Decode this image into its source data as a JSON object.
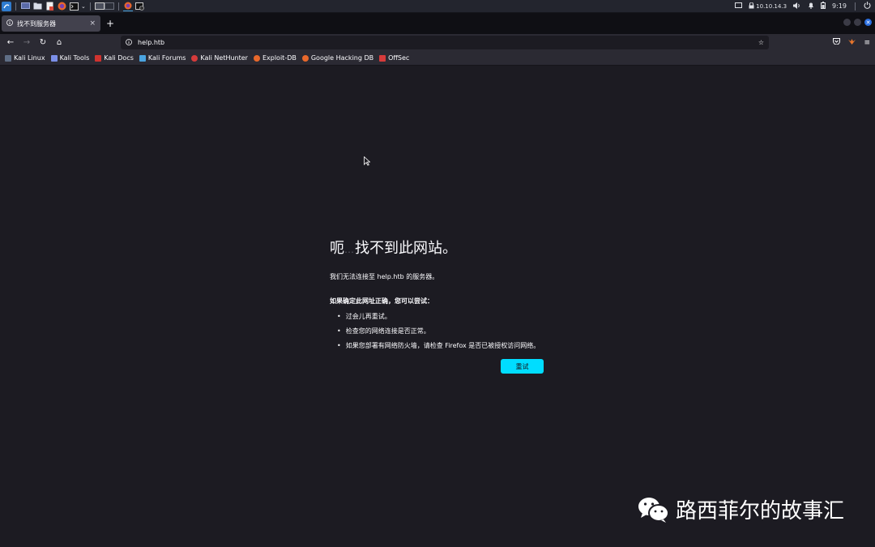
{
  "taskbar": {
    "ip": "10.10.14.3",
    "time": "9:19"
  },
  "tab": {
    "title": "找不到服务器",
    "close": "×",
    "new_tab": "+"
  },
  "nav": {
    "url": "help.htb"
  },
  "bookmarks": [
    {
      "label": "Kali Linux",
      "color": "#5f6e86"
    },
    {
      "label": "Kali Tools",
      "color": "#7b8fe8"
    },
    {
      "label": "Kali Docs",
      "color": "#d0332f"
    },
    {
      "label": "Kali Forums",
      "color": "#4aa3df"
    },
    {
      "label": "Kali NetHunter",
      "color": "#d63b3b"
    },
    {
      "label": "Exploit-DB",
      "color": "#e8682b"
    },
    {
      "label": "Google Hacking DB",
      "color": "#e8682b"
    },
    {
      "label": "OffSec",
      "color": "#d63b3b"
    }
  ],
  "error": {
    "title_prefix": "呃",
    "title_dots": "…",
    "title_main": "找不到此网站。",
    "description": "我们无法连接至 help.htb 的服务器。",
    "suggest_heading": "如果确定此网址正确，您可以尝试：",
    "suggestions": [
      "过会儿再重试。",
      "检查您的网络连接是否正常。",
      "如果您部署有网络防火墙，请检查 Firefox 是否已被授权访问网络。"
    ],
    "retry": "重试"
  },
  "watermark": "路西菲尔的故事汇",
  "colors": {
    "accent": "#00ddff",
    "page_bg": "#1c1b22",
    "toolbar_bg": "#2b2a33"
  }
}
